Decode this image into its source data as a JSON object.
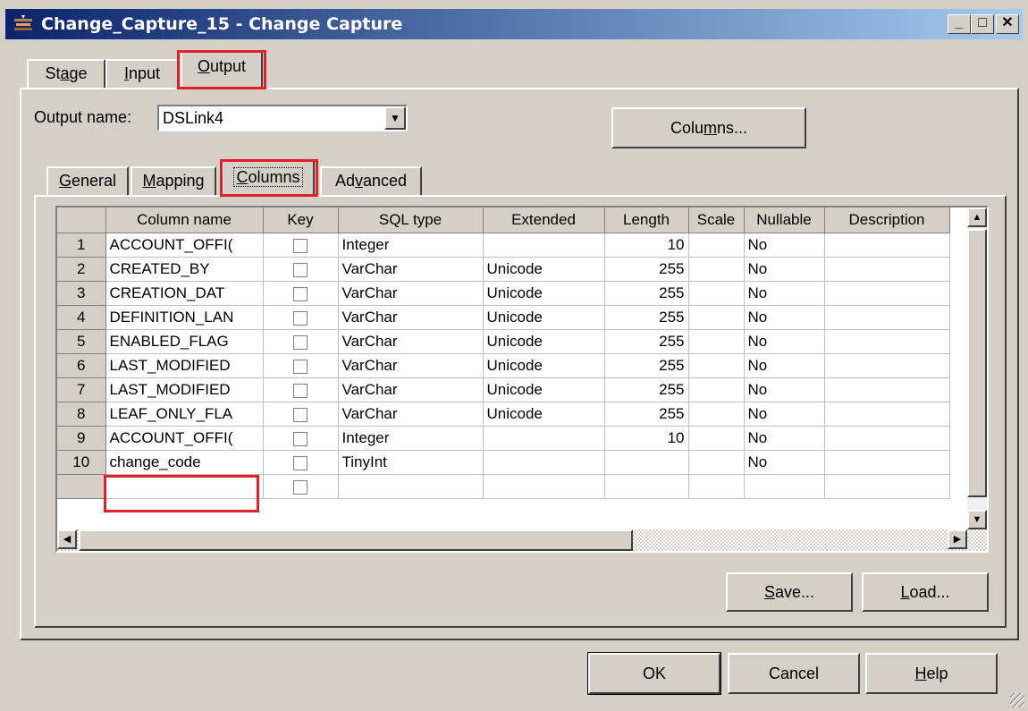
{
  "window": {
    "title": "Change_Capture_15 - Change Capture",
    "controls": {
      "minimize": "_",
      "maximize": "□",
      "close": "✕"
    }
  },
  "main_tabs": [
    {
      "label_pre": "St",
      "label_u": "a",
      "label_post": "ge"
    },
    {
      "label_pre": "",
      "label_u": "I",
      "label_post": "nput"
    },
    {
      "label_pre": "",
      "label_u": "O",
      "label_post": "utput"
    }
  ],
  "output": {
    "name_label": "Output name:",
    "name_value": "DSLink4",
    "columns_button_pre": "Colu",
    "columns_button_u": "m",
    "columns_button_post": "ns..."
  },
  "sub_tabs": [
    {
      "label_pre": "",
      "label_u": "G",
      "label_post": "eneral"
    },
    {
      "label_pre": "",
      "label_u": "M",
      "label_post": "apping"
    },
    {
      "label_pre": "",
      "label_u": "C",
      "label_post": "olumns"
    },
    {
      "label_pre": "Ad",
      "label_u": "v",
      "label_post": "anced"
    }
  ],
  "grid": {
    "headers": [
      "",
      "Column name",
      "Key",
      "SQL type",
      "Extended",
      "Length",
      "Scale",
      "Nullable",
      "Description"
    ],
    "rows": [
      {
        "n": "1",
        "name": "ACCOUNT_OFFI(",
        "type": "Integer",
        "ext": "",
        "len": "10",
        "scale": "",
        "nullable": "No",
        "desc": ""
      },
      {
        "n": "2",
        "name": "CREATED_BY",
        "type": "VarChar",
        "ext": "Unicode",
        "len": "255",
        "scale": "",
        "nullable": "No",
        "desc": ""
      },
      {
        "n": "3",
        "name": "CREATION_DAT",
        "type": "VarChar",
        "ext": "Unicode",
        "len": "255",
        "scale": "",
        "nullable": "No",
        "desc": ""
      },
      {
        "n": "4",
        "name": "DEFINITION_LAN",
        "type": "VarChar",
        "ext": "Unicode",
        "len": "255",
        "scale": "",
        "nullable": "No",
        "desc": ""
      },
      {
        "n": "5",
        "name": "ENABLED_FLAG",
        "type": "VarChar",
        "ext": "Unicode",
        "len": "255",
        "scale": "",
        "nullable": "No",
        "desc": ""
      },
      {
        "n": "6",
        "name": "LAST_MODIFIED",
        "type": "VarChar",
        "ext": "Unicode",
        "len": "255",
        "scale": "",
        "nullable": "No",
        "desc": ""
      },
      {
        "n": "7",
        "name": "LAST_MODIFIED",
        "type": "VarChar",
        "ext": "Unicode",
        "len": "255",
        "scale": "",
        "nullable": "No",
        "desc": ""
      },
      {
        "n": "8",
        "name": "LEAF_ONLY_FLA",
        "type": "VarChar",
        "ext": "Unicode",
        "len": "255",
        "scale": "",
        "nullable": "No",
        "desc": ""
      },
      {
        "n": "9",
        "name": "ACCOUNT_OFFI(",
        "type": "Integer",
        "ext": "",
        "len": "10",
        "scale": "",
        "nullable": "No",
        "desc": ""
      },
      {
        "n": "10",
        "name": "change_code",
        "type": "TinyInt",
        "ext": "",
        "len": "",
        "scale": "",
        "nullable": "No",
        "desc": ""
      },
      {
        "n": "",
        "name": "",
        "type": "",
        "ext": "",
        "len": "",
        "scale": "",
        "nullable": "",
        "desc": ""
      }
    ]
  },
  "panel_buttons": {
    "save_u": "S",
    "save_post": "ave...",
    "load_u": "L",
    "load_post": "oad..."
  },
  "dialog_buttons": {
    "ok": "OK",
    "cancel": "Cancel",
    "help_u": "H",
    "help_post": "elp"
  },
  "colors": {
    "title_start": "#0a246a",
    "title_end": "#a6caf0",
    "highlight": "#e3202a",
    "face": "#d4d0c8"
  }
}
